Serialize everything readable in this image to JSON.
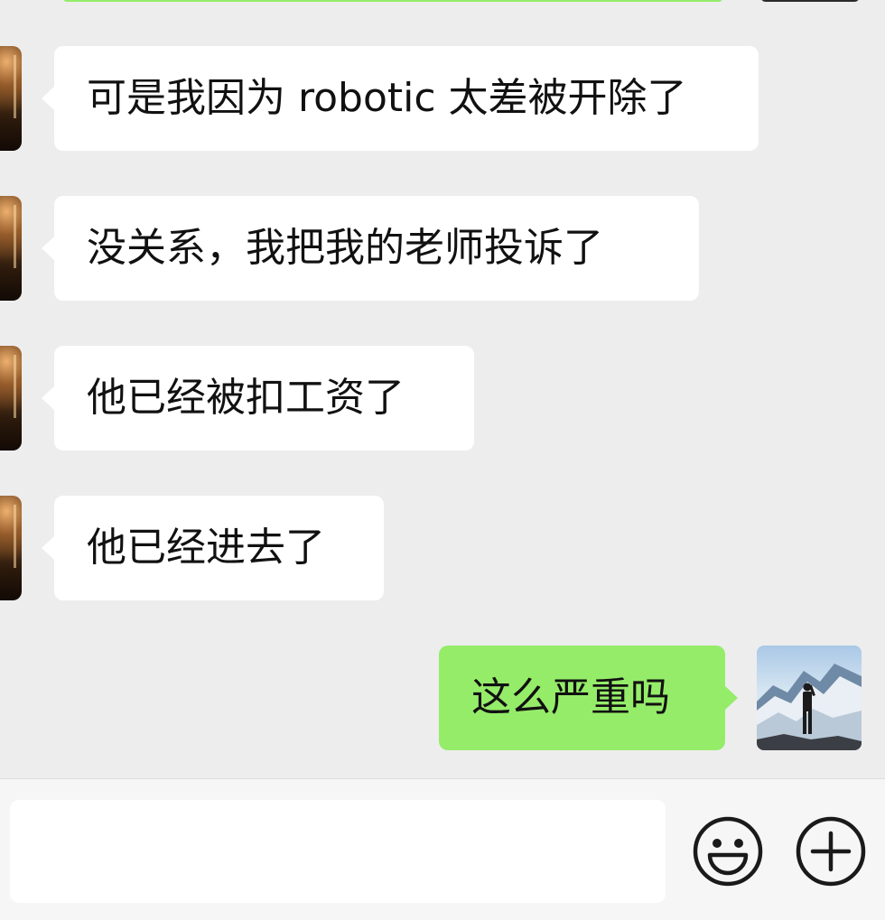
{
  "colors": {
    "background": "#ededed",
    "incoming_bubble": "#ffffff",
    "outgoing_bubble": "#95ec69",
    "text": "#111111",
    "icon_stroke": "#1a1a1a"
  },
  "messages": [
    {
      "direction": "incoming",
      "text": "可是我因为 robotic 太差被开除了"
    },
    {
      "direction": "incoming",
      "text": "没关系，我把我的老师投诉了"
    },
    {
      "direction": "incoming",
      "text": "他已经被扣工资了"
    },
    {
      "direction": "incoming",
      "text": "他已经进去了"
    },
    {
      "direction": "outgoing",
      "text": "这么严重吗"
    }
  ],
  "input_bar": {
    "message_value": "",
    "emoji_icon": "emoji-icon",
    "add_icon": "add-icon"
  }
}
